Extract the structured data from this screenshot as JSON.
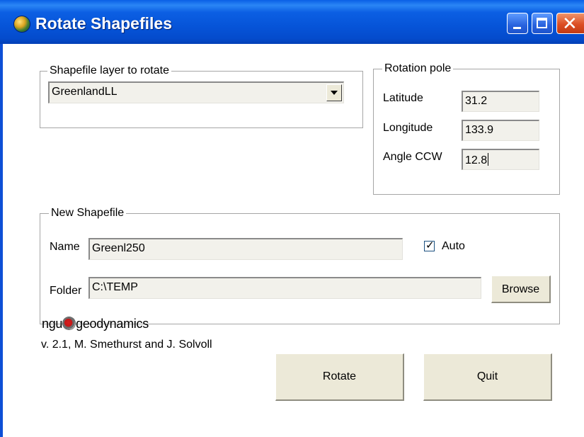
{
  "window": {
    "title": "Rotate Shapefiles",
    "icon": "globe-icon",
    "controls": [
      "minimize-icon",
      "maximize-icon",
      "close-icon"
    ],
    "colors": {
      "titlebar": "#0654d8",
      "close_button": "#dc4e24",
      "face": "#ece9d8"
    }
  },
  "layer_group": {
    "legend": "Shapefile layer to rotate",
    "selected_layer": "GreenlandLL"
  },
  "pole_group": {
    "legend": "Rotation pole",
    "latitude_label": "Latitude",
    "latitude_value": "31.2",
    "longitude_label": "Longitude",
    "longitude_value": "133.9",
    "angle_label": "Angle CCW",
    "angle_value": "12.8"
  },
  "new_shapefile": {
    "legend": "New Shapefile",
    "name_label": "Name",
    "name_value": "Greenl250",
    "auto_label": "Auto",
    "auto_checked": true,
    "folder_label": "Folder",
    "folder_value": "C:\\TEMP",
    "browse_label": "Browse"
  },
  "footer": {
    "logo_prefix": "ngu",
    "logo_suffix": "geodynamics",
    "version": "v. 2.1, M. Smethurst and J. Solvoll",
    "rotate_label": "Rotate",
    "quit_label": "Quit"
  }
}
